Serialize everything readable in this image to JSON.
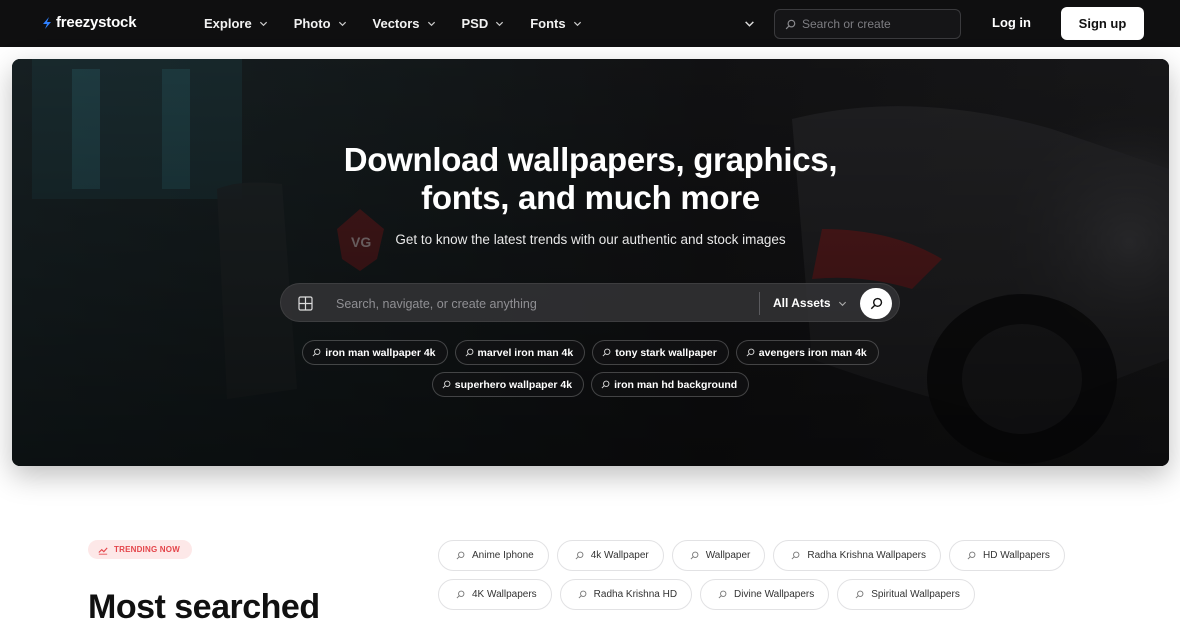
{
  "nav": {
    "logo": "freezystock",
    "menu": [
      {
        "label": "Explore"
      },
      {
        "label": "Photo"
      },
      {
        "label": "Vectors"
      },
      {
        "label": "PSD"
      },
      {
        "label": "Fonts"
      }
    ],
    "search_placeholder": "Search or create",
    "login": "Log in",
    "signup": "Sign up"
  },
  "hero": {
    "title_line1": "Download wallpapers, graphics,",
    "title_line2": "fonts, and much more",
    "subtitle": "Get to know the latest trends with our authentic and stock images",
    "search_placeholder": "Search, navigate, or create anything",
    "asset_filter": "All Assets",
    "suggestions_row1": [
      "iron man wallpaper 4k",
      "marvel iron man 4k",
      "tony stark wallpaper",
      "avengers iron man 4k"
    ],
    "suggestions_row2": [
      "superhero wallpaper 4k",
      "iron man hd background"
    ]
  },
  "trending": {
    "badge": "TRENDING NOW",
    "heading": "Most searched",
    "tags_row1": [
      "Anime Iphone",
      "4k Wallpaper",
      "Wallpaper",
      "Radha Krishna Wallpapers",
      "HD Wallpapers"
    ],
    "tags_row2": [
      "4K Wallpapers",
      "Radha Krishna HD",
      "Divine Wallpapers",
      "Spiritual Wallpapers"
    ]
  },
  "colors": {
    "nav_bg": "#0f0f10",
    "trend_accent": "#e4444a",
    "trend_badge_bg": "#fde8e8"
  },
  "icons": {
    "logo": "lightning-bolt-icon",
    "search": "search-icon",
    "grid": "grid-icon",
    "chevron": "chevron-down-icon",
    "trend": "trend-chart-icon"
  }
}
